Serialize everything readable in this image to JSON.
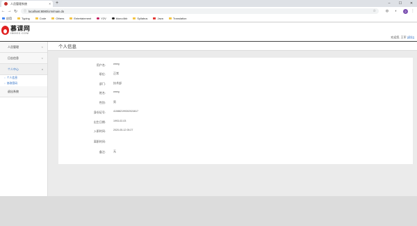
{
  "browser": {
    "tab_title": "人员管理系统",
    "url": "localhost:8080/crm/main.do",
    "avatar_letter": "2",
    "bookmarks": [
      "应用",
      "Typing",
      "Code",
      "Others",
      "Entertainment",
      "Y2V",
      "bluno4bb",
      "Syllabus",
      "Java",
      "Translation"
    ]
  },
  "header": {
    "logo_title": "慕课网",
    "logo_sub": "IMOOC.COM",
    "welcome_prefix": "欢迎您, 王军",
    "logout": "[退出]"
  },
  "sidebar": {
    "items": [
      {
        "label": "人员管理",
        "caret": "<"
      },
      {
        "label": "日志信息",
        "caret": "<"
      },
      {
        "label": "个人中心",
        "caret": "v"
      }
    ],
    "sub_items": [
      {
        "label": "个人信息"
      },
      {
        "label": "修改密码"
      }
    ],
    "last_item": {
      "label": "退出系统"
    }
  },
  "main": {
    "title": "个人信息",
    "fields": [
      {
        "label": "用户名:",
        "value": "wang"
      },
      {
        "label": "职位:",
        "value": "正常"
      },
      {
        "label": "部门:",
        "value": "技术部"
      },
      {
        "label": "姓名:",
        "value": "wang"
      },
      {
        "label": "性别:",
        "value": "男"
      },
      {
        "label": "身份证号:",
        "value": "410882199302024617"
      },
      {
        "label": "出生日期:",
        "value": "1993-02-03"
      },
      {
        "label": "入职时间:",
        "value": "2020-05-12 05:27"
      },
      {
        "label": "离职时间:",
        "value": ""
      },
      {
        "label": "备注:",
        "value": "无"
      }
    ]
  }
}
